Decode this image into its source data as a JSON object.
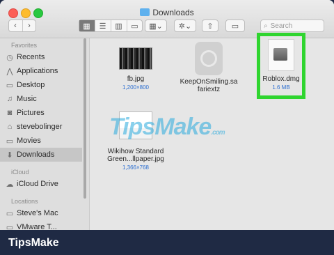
{
  "window": {
    "title": "Downloads"
  },
  "toolbar": {
    "search_placeholder": "Search"
  },
  "sidebar": {
    "sections": [
      {
        "label": "Favorites"
      },
      {
        "label": "iCloud"
      },
      {
        "label": "Locations"
      }
    ],
    "items": [
      {
        "label": "Recents",
        "icon": "clock-icon"
      },
      {
        "label": "Applications",
        "icon": "applications-icon"
      },
      {
        "label": "Desktop",
        "icon": "desktop-icon"
      },
      {
        "label": "Music",
        "icon": "music-icon"
      },
      {
        "label": "Pictures",
        "icon": "camera-icon"
      },
      {
        "label": "stevebolinger",
        "icon": "home-icon"
      },
      {
        "label": "Movies",
        "icon": "folder-icon"
      },
      {
        "label": "Downloads",
        "icon": "downloads-icon",
        "selected": true
      },
      {
        "label": "iCloud Drive",
        "icon": "cloud-icon"
      },
      {
        "label": "Steve's Mac",
        "icon": "computer-icon"
      },
      {
        "label": "VMware T...",
        "icon": "disk-icon"
      }
    ]
  },
  "files": [
    {
      "name": "fb.jpg",
      "meta": "1,200×800"
    },
    {
      "name_line1": "KeepOnSmiling.sa",
      "name_line2": "fariextz"
    },
    {
      "name": "Roblox.dmg",
      "meta": "1.6 MB",
      "highlighted": true
    },
    {
      "name_line1": "Wikihow Standard",
      "name_line2": "Green...llpaper.jpg",
      "meta": "1,366×768"
    }
  ],
  "watermark": {
    "text": "TipsMake",
    "suffix": ".com"
  },
  "footer": {
    "brand": "TipsMake"
  },
  "colors": {
    "highlight": "#2fd52f",
    "footer_bg": "#1f2a44",
    "selection": "#c6c6c6"
  }
}
